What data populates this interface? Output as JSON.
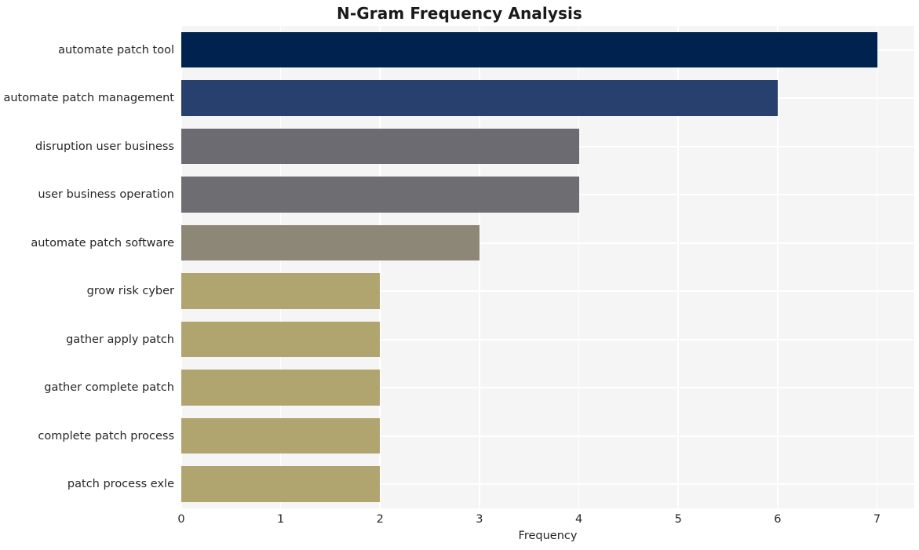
{
  "chart_data": {
    "type": "bar",
    "orientation": "horizontal",
    "title": "N-Gram Frequency Analysis",
    "xlabel": "Frequency",
    "ylabel": "",
    "categories": [
      "automate patch tool",
      "automate patch management",
      "disruption user business",
      "user business operation",
      "automate patch software",
      "grow risk cyber",
      "gather apply patch",
      "gather complete patch",
      "complete patch process",
      "patch process exle"
    ],
    "values": [
      7,
      6,
      4,
      4,
      3,
      2,
      2,
      2,
      2,
      2
    ],
    "bar_colors": [
      "#00224e",
      "#27406e",
      "#6b6b71",
      "#6d6d72",
      "#8d8777",
      "#b0a56f",
      "#b0a56f",
      "#b0a56f",
      "#b0a56f",
      "#b0a56f"
    ],
    "xlim": [
      0,
      7.375
    ],
    "xticks": [
      0,
      1,
      2,
      3,
      4,
      5,
      6,
      7
    ],
    "xtick_labels": [
      "0",
      "1",
      "2",
      "3",
      "4",
      "5",
      "6",
      "7"
    ],
    "grid": true,
    "grid_color": "#ffffff",
    "plot_background": "#f5f5f6",
    "figure_background": "#ffffff",
    "legend": null
  }
}
